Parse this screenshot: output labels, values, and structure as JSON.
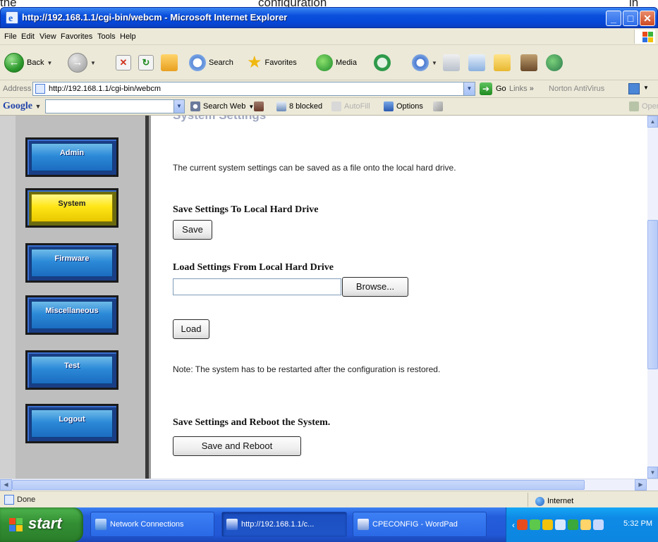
{
  "caption": {
    "word1": "the",
    "word2": "configuration",
    "word3": "in"
  },
  "window": {
    "title": "http://192.168.1.1/cgi-bin/webcm - Microsoft Internet Explorer"
  },
  "menu": [
    "File",
    "Edit",
    "View",
    "Favorites",
    "Tools",
    "Help"
  ],
  "toolbar": {
    "back": "Back",
    "search": "Search",
    "favorites": "Favorites",
    "media": "Media"
  },
  "address": {
    "label": "Address",
    "url": "http://192.168.1.1/cgi-bin/webcm",
    "go": "Go",
    "links": "Links",
    "chevron": "»",
    "norton": "Norton AntiVirus"
  },
  "google": {
    "logo": "Google",
    "search_web": "Search Web",
    "blocked": "8 blocked",
    "autofill": "AutoFill",
    "options": "Options",
    "open": "Open"
  },
  "nav": [
    {
      "label": "Admin",
      "active": false
    },
    {
      "label": "System",
      "active": true
    },
    {
      "label": "Firmware",
      "active": false
    },
    {
      "label": "Miscellaneous",
      "active": false
    },
    {
      "label": "Test",
      "active": false
    },
    {
      "label": "Logout",
      "active": false
    }
  ],
  "content": {
    "heading": "System Settings",
    "intro": "The current system settings can be saved as a file onto the local hard drive.",
    "save_heading": "Save Settings To Local Hard Drive",
    "save_button": "Save",
    "load_heading": "Load Settings From Local Hard Drive",
    "file_value": "",
    "browse_button": "Browse...",
    "load_button": "Load",
    "note": "Note: The system has to be restarted after the configuration is restored.",
    "reboot_heading": "Save Settings and Reboot the System.",
    "reboot_button": "Save and Reboot"
  },
  "status": {
    "text": "Done",
    "zone": "Internet"
  },
  "taskbar": {
    "start": "start",
    "tasks": [
      "Network Connections",
      "http://192.168.1.1/c...",
      "CPECONFIG - WordPad"
    ],
    "clock": "5:32 PM"
  },
  "colors": {
    "title_blue": "#0647d8",
    "nav_blue": "#2c8ad8",
    "nav_active_yellow": "#ffe617",
    "taskbar_blue": "#245edb",
    "start_green": "#338f33"
  }
}
